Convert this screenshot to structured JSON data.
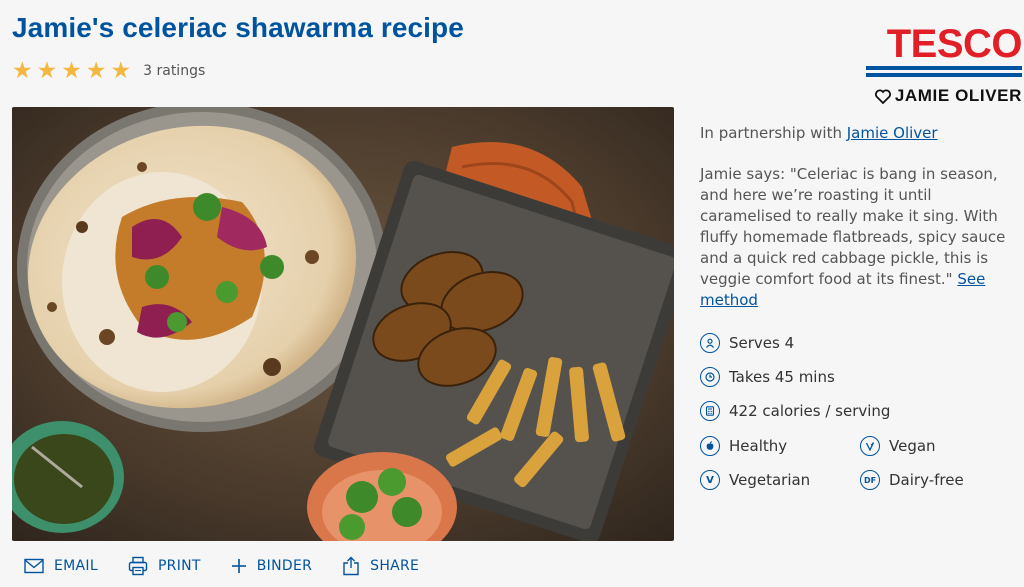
{
  "recipe": {
    "title": "Jamie's celeriac shawarma recipe",
    "rating_stars": 5,
    "rating_text": "3 ratings"
  },
  "brand": {
    "tesco": "TESCO",
    "partner_logo": "JAMIE OLIVER",
    "accent": "#00539f",
    "red": "#e21f26"
  },
  "side": {
    "partnership_prefix": "In partnership with",
    "partnership_link": "Jamie Oliver",
    "description": "Jamie says: \"Celeriac is bang in season, and here we’re roasting it until caramelised to really make it sing. With fluffy homemade flatbreads, spicy sauce and a quick red cabbage pickle, this is veggie comfort food at its finest.\"",
    "see_method": "See method"
  },
  "facts": {
    "serves": "Serves 4",
    "takes": "Takes 45 mins",
    "calories": "422 calories / serving",
    "healthy": "Healthy",
    "vegan": "Vegan",
    "vegetarian": "Vegetarian",
    "dairy_free": "Dairy-free"
  },
  "actions": {
    "email": "EMAIL",
    "print": "PRINT",
    "binder": "BINDER",
    "share": "SHARE"
  }
}
